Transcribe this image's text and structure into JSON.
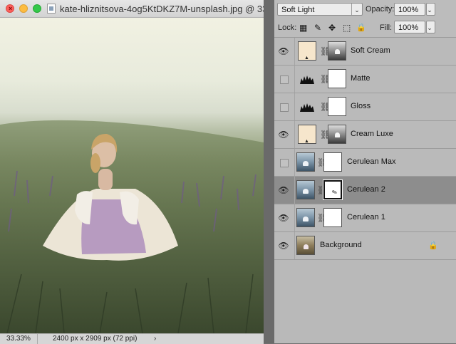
{
  "window": {
    "title": "kate-hliznitsova-4og5KtDKZ7M-unsplash.jpg @ 33....",
    "close_glyph": "×"
  },
  "status": {
    "zoom": "33.33%",
    "dimensions": "2400 px x 2909 px (72 ppi)",
    "arrow": "›"
  },
  "options": {
    "blend_mode": "Soft Light",
    "opacity_label": "Opacity:",
    "opacity_value": "100%",
    "lock_label": "Lock:",
    "fill_label": "Fill:",
    "fill_value": "100%",
    "chevron": "⌄"
  },
  "icons": {
    "eye": "👁",
    "chain": "⛓",
    "lock_transparent": "▦",
    "lock_paint": "✎",
    "lock_move": "✥",
    "lock_artboard": "⬚",
    "lock_all": "🔒",
    "padlock": "🔒",
    "levels_glyph": "▲"
  },
  "layers": [
    {
      "name": "Soft Cream",
      "visible": true,
      "thumb": "cream",
      "mask": "dark",
      "adjustment": false
    },
    {
      "name": "Matte",
      "visible": false,
      "thumb": "levels",
      "mask": "white",
      "adjustment": true
    },
    {
      "name": "Gloss",
      "visible": false,
      "thumb": "levels",
      "mask": "white",
      "adjustment": true
    },
    {
      "name": "Cream Luxe",
      "visible": true,
      "thumb": "cream",
      "mask": "dark",
      "adjustment": false
    },
    {
      "name": "Cerulean Max",
      "visible": false,
      "thumb": "photo",
      "mask": "white",
      "adjustment": false
    },
    {
      "name": "Cerulean 2",
      "visible": true,
      "thumb": "photo",
      "mask": "white",
      "adjustment": false,
      "selected": true
    },
    {
      "name": "Cerulean 1",
      "visible": true,
      "thumb": "photo",
      "mask": "white",
      "adjustment": false
    },
    {
      "name": "Background",
      "visible": true,
      "thumb": "bg",
      "mask": null,
      "adjustment": false,
      "locked": true
    }
  ]
}
